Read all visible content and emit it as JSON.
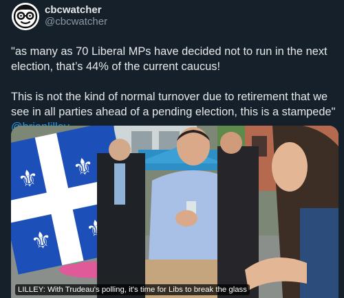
{
  "author": {
    "display_name": "cbcwatcher",
    "handle": "@cbcwatcher",
    "avatar_icon": "face-with-glasses-icon"
  },
  "tweet": {
    "paragraph_1": "\"as many as 70 Liberal MPs have decided not to run in the next election, that’s 44% of the current caucus!",
    "paragraph_2_text": "This is not the kind of normal turnover due to retirement that we see in all parties ahead of a pending election, this is a stampede\" ",
    "paragraph_2_mention": "@brianlilley"
  },
  "media": {
    "caption": "LILLEY: With Trudeau's polling, it's time for Libs to break the glass"
  },
  "colors": {
    "background": "#15202b",
    "text": "#e7e9ea",
    "secondary_text": "#8b98a5",
    "link": "#1d9bf0"
  }
}
